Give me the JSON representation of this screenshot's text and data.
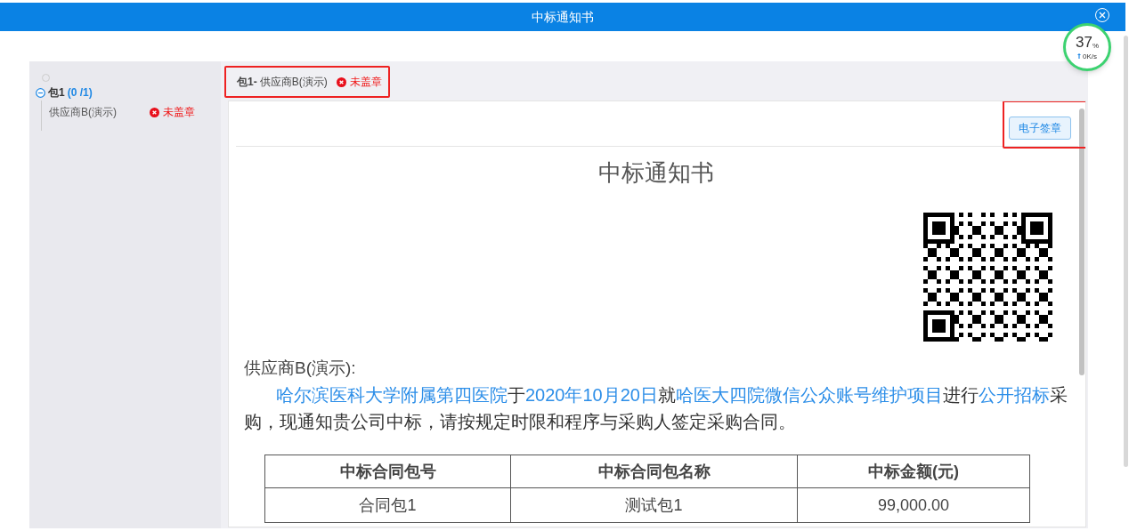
{
  "window": {
    "title": "中标通知书"
  },
  "speed_widget": {
    "percent": "37",
    "unit": "%",
    "speed": "0K/s"
  },
  "tree": [
    {
      "label": "包1",
      "count": "(0 /1)",
      "expanded": true,
      "children": [
        {
          "label": "供应商B(演示)",
          "status": "未盖章",
          "stamped": false
        }
      ]
    }
  ],
  "header": {
    "package": "包1-",
    "supplier": "供应商B(演示)",
    "status": "未盖章",
    "stamped": false
  },
  "toolbar": {
    "button": "电子签章"
  },
  "document": {
    "title": "中标通知书",
    "salutation": "供应商B(演示):",
    "paragraph": [
      {
        "text": "哈尔滨医科大学附属第四医院",
        "filled": true
      },
      {
        "text": "于",
        "filled": false
      },
      {
        "text": "2020年10月20日",
        "filled": true
      },
      {
        "text": "就",
        "filled": false
      },
      {
        "text": "哈医大四院微信公众账号维护项目",
        "filled": true
      },
      {
        "text": "进行",
        "filled": false
      },
      {
        "text": "公开招标",
        "filled": true
      },
      {
        "text": "采购，现通知贵公司中标，请按规定时限和程序与采购人签定采购合同。",
        "filled": false
      }
    ],
    "table": {
      "columns": [
        "中标合同包号",
        "中标合同包名称",
        "中标金额(元)"
      ],
      "rows": [
        [
          "合同包1",
          "测试包1",
          "99,000.00"
        ]
      ]
    }
  }
}
